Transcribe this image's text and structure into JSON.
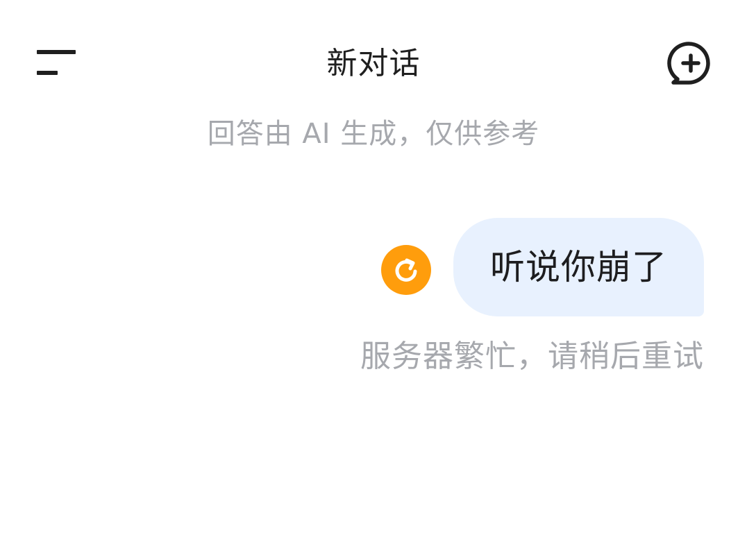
{
  "header": {
    "title": "新对话",
    "menu_icon": "menu-icon",
    "new_chat_icon": "new-chat-plus-icon"
  },
  "disclaimer": "回答由 AI 生成，仅供参考",
  "conversation": {
    "user_message": "听说你崩了",
    "retry_icon": "retry-refresh-icon",
    "error_message": "服务器繁忙，请稍后重试"
  },
  "colors": {
    "background": "#ffffff",
    "title": "#1f1f1f",
    "muted_text": "#a6a8ad",
    "user_bubble": "#e8f1fe",
    "retry_accent": "#ff9d0c"
  }
}
